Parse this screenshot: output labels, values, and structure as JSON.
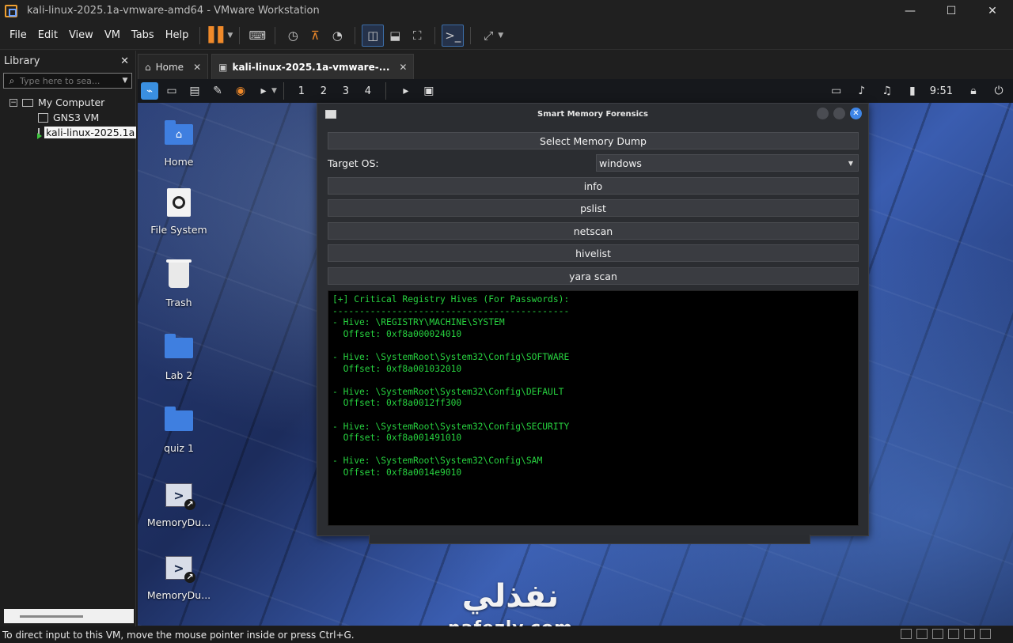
{
  "window": {
    "title": "kali-linux-2025.1a-vmware-amd64 - VMware Workstation",
    "minimize": "—",
    "maximize": "☐",
    "close": "✕"
  },
  "menu": [
    "File",
    "Edit",
    "View",
    "VM",
    "Tabs",
    "Help"
  ],
  "library": {
    "title": "Library",
    "close": "✕",
    "search_placeholder": "Type here to sea...",
    "root": "My Computer",
    "vms": [
      "GNS3 VM",
      "kali-linux-2025.1a"
    ]
  },
  "tabs": [
    {
      "label": "Home",
      "close": "✕"
    },
    {
      "label": "kali-linux-2025.1a-vmware-...",
      "close": "✕"
    }
  ],
  "kali_panel": {
    "workspaces": [
      "1",
      "2",
      "3",
      "4"
    ],
    "clock": "9:51"
  },
  "desktop_icons": [
    {
      "label": "Home",
      "icon": "home-folder-icon"
    },
    {
      "label": "File System",
      "icon": "drive-icon"
    },
    {
      "label": "Trash",
      "icon": "trash-icon"
    },
    {
      "label": "Lab 2",
      "icon": "folder-icon"
    },
    {
      "label": "quiz 1",
      "icon": "folder-icon"
    },
    {
      "label": "MemoryDu...",
      "icon": "script-link-icon"
    },
    {
      "label": "MemoryDu...",
      "icon": "script-link-icon"
    }
  ],
  "app": {
    "title": "Smart Memory Forensics",
    "select_dump": "Select Memory Dump",
    "target_os_label": "Target OS:",
    "target_os_value": "windows",
    "buttons": [
      "info",
      "pslist",
      "netscan",
      "hivelist",
      "yara scan"
    ],
    "console_lines": [
      "[+] Critical Registry Hives (For Passwords):",
      "--------------------------------------------",
      "- Hive: \\REGISTRY\\MACHINE\\SYSTEM",
      "  Offset: 0xf8a000024010",
      "",
      "- Hive: \\SystemRoot\\System32\\Config\\SOFTWARE",
      "  Offset: 0xf8a001032010",
      "",
      "- Hive: \\SystemRoot\\System32\\Config\\DEFAULT",
      "  Offset: 0xf8a0012ff300",
      "",
      "- Hive: \\SystemRoot\\System32\\Config\\SECURITY",
      "  Offset: 0xf8a001491010",
      "",
      "- Hive: \\SystemRoot\\System32\\Config\\SAM",
      "  Offset: 0xf8a0014e9010"
    ]
  },
  "watermark": {
    "arabic": "نفذلي",
    "latin": "nafezly.com"
  },
  "status": {
    "text": "To direct input to this VM, move the mouse pointer inside or press Ctrl+G."
  },
  "colors": {
    "console_text": "#27d13f",
    "pause_accent": "#f08a2a",
    "kali_blue": "#3a8fe0"
  }
}
